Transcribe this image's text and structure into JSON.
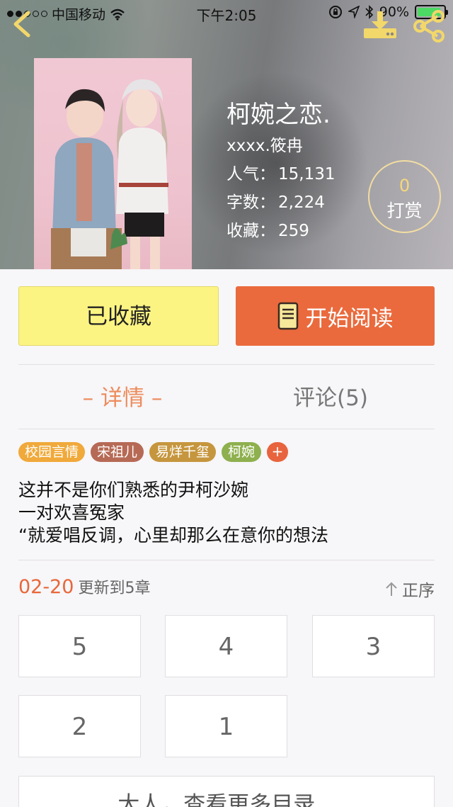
{
  "status_bar": {
    "carrier": "中国移动",
    "time": "下午2:05",
    "battery": "90%"
  },
  "book": {
    "title": "柯婉之恋.",
    "author": "xxxx.筱冉",
    "stats": [
      {
        "label": "人气：",
        "value": "15,131"
      },
      {
        "label": "字数：",
        "value": "2,224"
      },
      {
        "label": "收藏：",
        "value": "259"
      }
    ],
    "reward": {
      "count": "0",
      "label": "打赏"
    }
  },
  "actions": {
    "favorited_label": "已收藏",
    "start_reading_label": "开始阅读"
  },
  "tabs": {
    "detail": "– 详情 –",
    "comments": "评论(5)"
  },
  "tags": [
    {
      "label": "校园言情",
      "color": "#f0a93a"
    },
    {
      "label": "宋祖儿",
      "color": "#b66a55"
    },
    {
      "label": "易烊千玺",
      "color": "#c6963e"
    },
    {
      "label": "柯婉",
      "color": "#8eb04e"
    }
  ],
  "tag_add": "+",
  "description": [
    "这并不是你们熟悉的尹柯沙婉",
    "一对欢喜冤家",
    "“就爱唱反调，心里却那么在意你的想法"
  ],
  "update": {
    "date": "02-20",
    "text": "更新到5章",
    "sort_label": "正序"
  },
  "chapters": [
    "5",
    "4",
    "3",
    "2",
    "1"
  ],
  "more_label": "大人，查看更多目录",
  "colors": {
    "accent_orange": "#ea6a3d",
    "favorite_yellow": "#fcf482",
    "tab_active": "#ec8c5d"
  }
}
